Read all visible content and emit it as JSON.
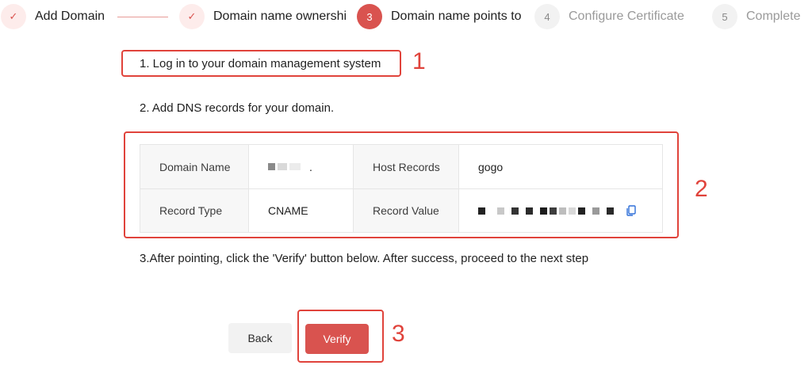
{
  "stepper": {
    "steps": [
      {
        "index": "✓",
        "label": "Add Domain",
        "state": "done"
      },
      {
        "index": "✓",
        "label": "Domain name ownership",
        "state": "done"
      },
      {
        "index": "3",
        "label": "Domain name points to",
        "state": "active"
      },
      {
        "index": "4",
        "label": "Configure Certificate",
        "state": "todo"
      },
      {
        "index": "5",
        "label": "Complete",
        "state": "todo"
      }
    ]
  },
  "instructions": {
    "step1": "1. Log in to your domain management system",
    "step2": "2. Add DNS records for your domain.",
    "step3": "3.After pointing, click the 'Verify' button below. After success, proceed to the next step"
  },
  "annotations": {
    "a1": "1",
    "a2": "2",
    "a3": "3"
  },
  "dns_table": {
    "domain_name_key": "Domain Name",
    "domain_name_value": ".",
    "host_records_key": "Host Records",
    "host_records_value": "gogo",
    "record_type_key": "Record Type",
    "record_type_value": "CNAME",
    "record_value_key": "Record Value"
  },
  "buttons": {
    "back": "Back",
    "verify": "Verify"
  },
  "colors": {
    "accent": "#d9534f",
    "annotation_red": "#e0433b"
  }
}
